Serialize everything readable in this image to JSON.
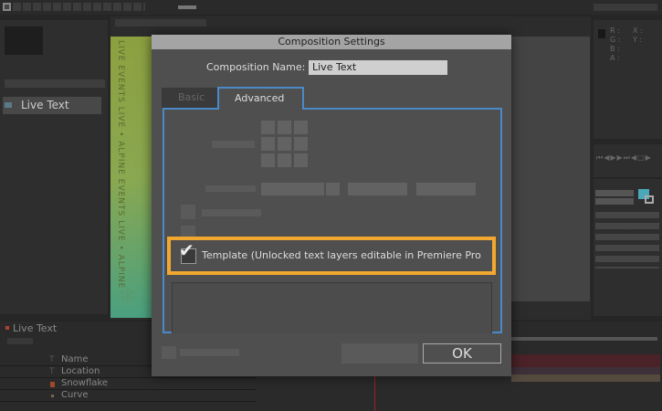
{
  "project_panel": {
    "item_label": "Live Text"
  },
  "info_panel": {
    "labels": [
      "R :",
      "G :",
      "B :",
      "A :",
      "X :",
      "Y :"
    ]
  },
  "timeline": {
    "tab_label": "Live Text",
    "layers": [
      {
        "name": "Name",
        "icon": "text-layer-icon"
      },
      {
        "name": "Location",
        "icon": "text-layer-icon"
      },
      {
        "name": "Snowflake",
        "icon": "shape-layer-icon"
      },
      {
        "name": "Curve",
        "icon": "solid-layer-icon"
      }
    ]
  },
  "poster": {
    "text": "LIVE EVENTS LIVE • ALPINE EVENTS LIVE • ALPINE"
  },
  "dialog": {
    "title": "Composition Settings",
    "name_label": "Composition Name:",
    "name_value": "Live Text",
    "tabs": [
      {
        "label": "Basic",
        "active": false
      },
      {
        "label": "Advanced",
        "active": true
      }
    ],
    "template_checkbox": {
      "label": "Template (Unlocked text layers editable in Premiere Pro",
      "checked": true
    },
    "ok_label": "OK"
  },
  "colors": {
    "highlight": "#f0a830",
    "tab_border": "#4a8ac8",
    "swatch": "#4aa8b8"
  }
}
